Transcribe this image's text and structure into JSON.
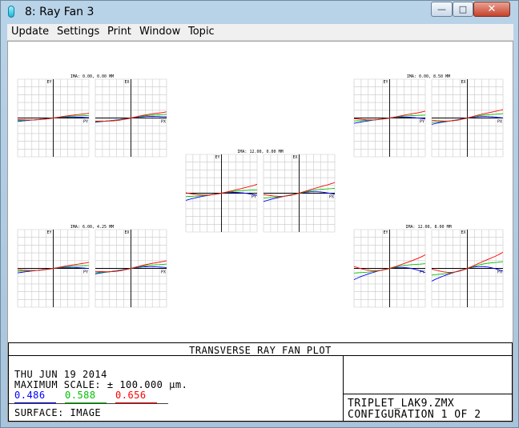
{
  "window": {
    "title": "8: Ray Fan 3",
    "controls": {
      "minimize": "—",
      "maximize": "□",
      "close": "✕"
    }
  },
  "menu": {
    "items": [
      "Update",
      "Settings",
      "Print",
      "Window",
      "Topic"
    ]
  },
  "plot": {
    "panels": [
      {
        "field": "IMA: 0.00, 0.00 MM",
        "ey": "EY",
        "ex": "EX",
        "py": "PY",
        "px": "PX"
      },
      {
        "field": "IMA: 0.00, 8.50 MM",
        "ey": "EY",
        "ex": "EX",
        "py": "PY",
        "px": "PX"
      },
      {
        "field": "IMA: 12.00, 0.00 MM",
        "ey": "EY",
        "ex": "EX",
        "py": "PY",
        "px": "PX"
      },
      {
        "field": "IMA: 6.00, 4.25 MM",
        "ey": "EY",
        "ex": "EX",
        "py": "PY",
        "px": "PX"
      },
      {
        "field": "IMA: 12.00, 8.00 MM",
        "ey": "EY",
        "ex": "EX",
        "py": "PY",
        "px": "PX"
      }
    ],
    "title": "TRANSVERSE RAY FAN PLOT",
    "date": "THU JUN 19 2014",
    "max_scale": "MAXIMUM SCALE: ± 100.000 µm.",
    "wavelengths": [
      "0.486",
      "0.588",
      "0.656"
    ],
    "wavelength_colors": [
      "#0000ff",
      "#00c000",
      "#ff0000"
    ],
    "surface": "SURFACE: IMAGE",
    "file": "TRIPLET_LAK9.ZMX",
    "config": "CONFIGURATION 1 OF 2"
  }
}
